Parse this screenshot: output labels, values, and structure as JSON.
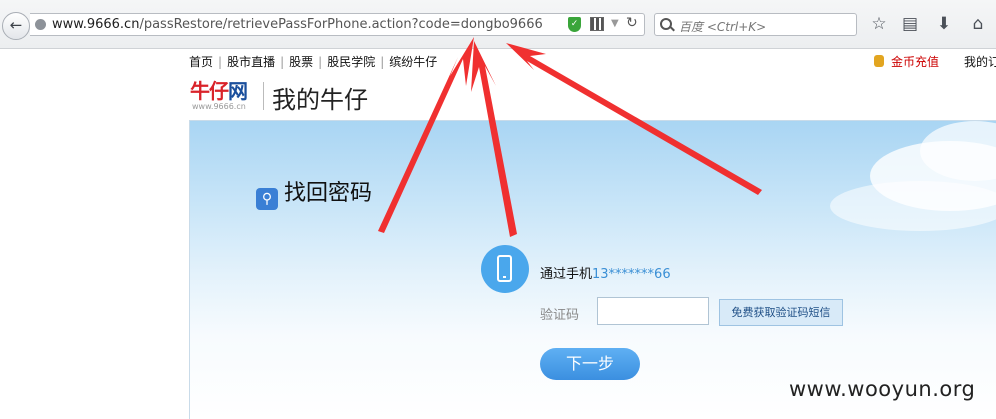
{
  "browser": {
    "url_host": "www.9666.cn",
    "url_path": "/passRestore/retrievePassForPhone.action?code=dongbo9666",
    "search_placeholder": "百度 <Ctrl+K>",
    "icons": [
      "back-arrow-icon",
      "globe-icon",
      "shield-icon",
      "qr-code-icon",
      "dropdown-icon",
      "reload-icon",
      "search-icon",
      "star-icon",
      "reading-list-icon",
      "download-icon",
      "home-icon"
    ]
  },
  "site_nav": {
    "items": [
      "首页",
      "股市直播",
      "股票",
      "股民学院",
      "缤纷牛仔"
    ],
    "gold_recharge": "金币充值",
    "my_orders": "我的订"
  },
  "logo": {
    "main_a": "牛仔",
    "main_b": "网",
    "sub": "www.9666.cn"
  },
  "page_title": "我的牛仔",
  "recover": {
    "title": "找回密码",
    "via_phone_label": "通过手机",
    "masked_phone": "13*******66",
    "code_label": "验证码",
    "code_value": "",
    "sms_button": "免费获取验证码短信",
    "next_button": "下一步"
  },
  "watermark": "www.wooyun.org",
  "colors": {
    "annotation_red": "#f03030",
    "brand_red": "#d9232a",
    "brand_blue": "#1a4f9c",
    "button_blue": "#3b8fe0"
  }
}
